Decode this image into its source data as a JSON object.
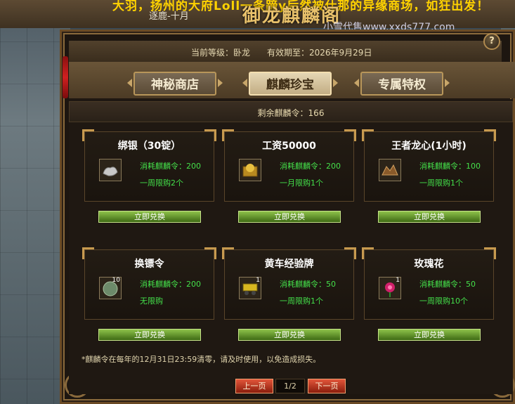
{
  "top_banner": {
    "marquee": "大羽，扬州的大府Loll一条蹄y后然被仕那的异缘商场，如狂出发！",
    "marquee_sub": "逐鹿-十月",
    "title": "御龙麒麟阁"
  },
  "watermark": "小雪代售www.xxds777.com",
  "header": {
    "level_label": "当前等级：卧龙",
    "validity_label": "有效期至：2026年9月29日",
    "help": "?"
  },
  "tabs": [
    {
      "label": "神秘商店",
      "active": false
    },
    {
      "label": "麒麟珍宝",
      "active": true
    },
    {
      "label": "专属特权",
      "active": false
    }
  ],
  "remaining": "剩余麒麟令：166",
  "items": [
    {
      "title": "绑银（30锭）",
      "icon": "silver-ingot-icon",
      "badge": "",
      "cost": "消耗麒麟令：200",
      "limit": "一周限购2个",
      "button": "立即兑换"
    },
    {
      "title": "工资50000",
      "icon": "wage-chest-icon",
      "badge": "",
      "cost": "消耗麒麟令：200",
      "limit": "一月限购1个",
      "button": "立即兑换"
    },
    {
      "title": "王者龙心(1小时)",
      "icon": "dragon-heart-icon",
      "badge": "",
      "cost": "消耗麒麟令：100",
      "limit": "一周限购1个",
      "button": "立即兑换"
    },
    {
      "title": "换镖令",
      "icon": "escort-token-icon",
      "badge": "10",
      "cost": "消耗麒麟令：200",
      "limit": "无限购",
      "button": "立即兑换"
    },
    {
      "title": "黄车经验牌",
      "icon": "yellow-cart-exp-icon",
      "badge": "1",
      "cost": "消耗麒麟令：50",
      "limit": "一周限购1个",
      "button": "立即兑换"
    },
    {
      "title": "玫瑰花",
      "icon": "rose-icon",
      "badge": "1",
      "cost": "消耗麒麟令：50",
      "limit": "一周限购10个",
      "button": "立即兑换"
    }
  ],
  "note": "*麒麟令在每年的12月31日23:59清零，请及时使用，以免造成损失。",
  "pager": {
    "prev": "上一页",
    "page": "1/2",
    "next": "下一页"
  },
  "colors": {
    "accent_gold": "#c79a4f",
    "text_green": "#44e04a",
    "button_green": "#5b8f24",
    "pager_red": "#b8321c"
  }
}
